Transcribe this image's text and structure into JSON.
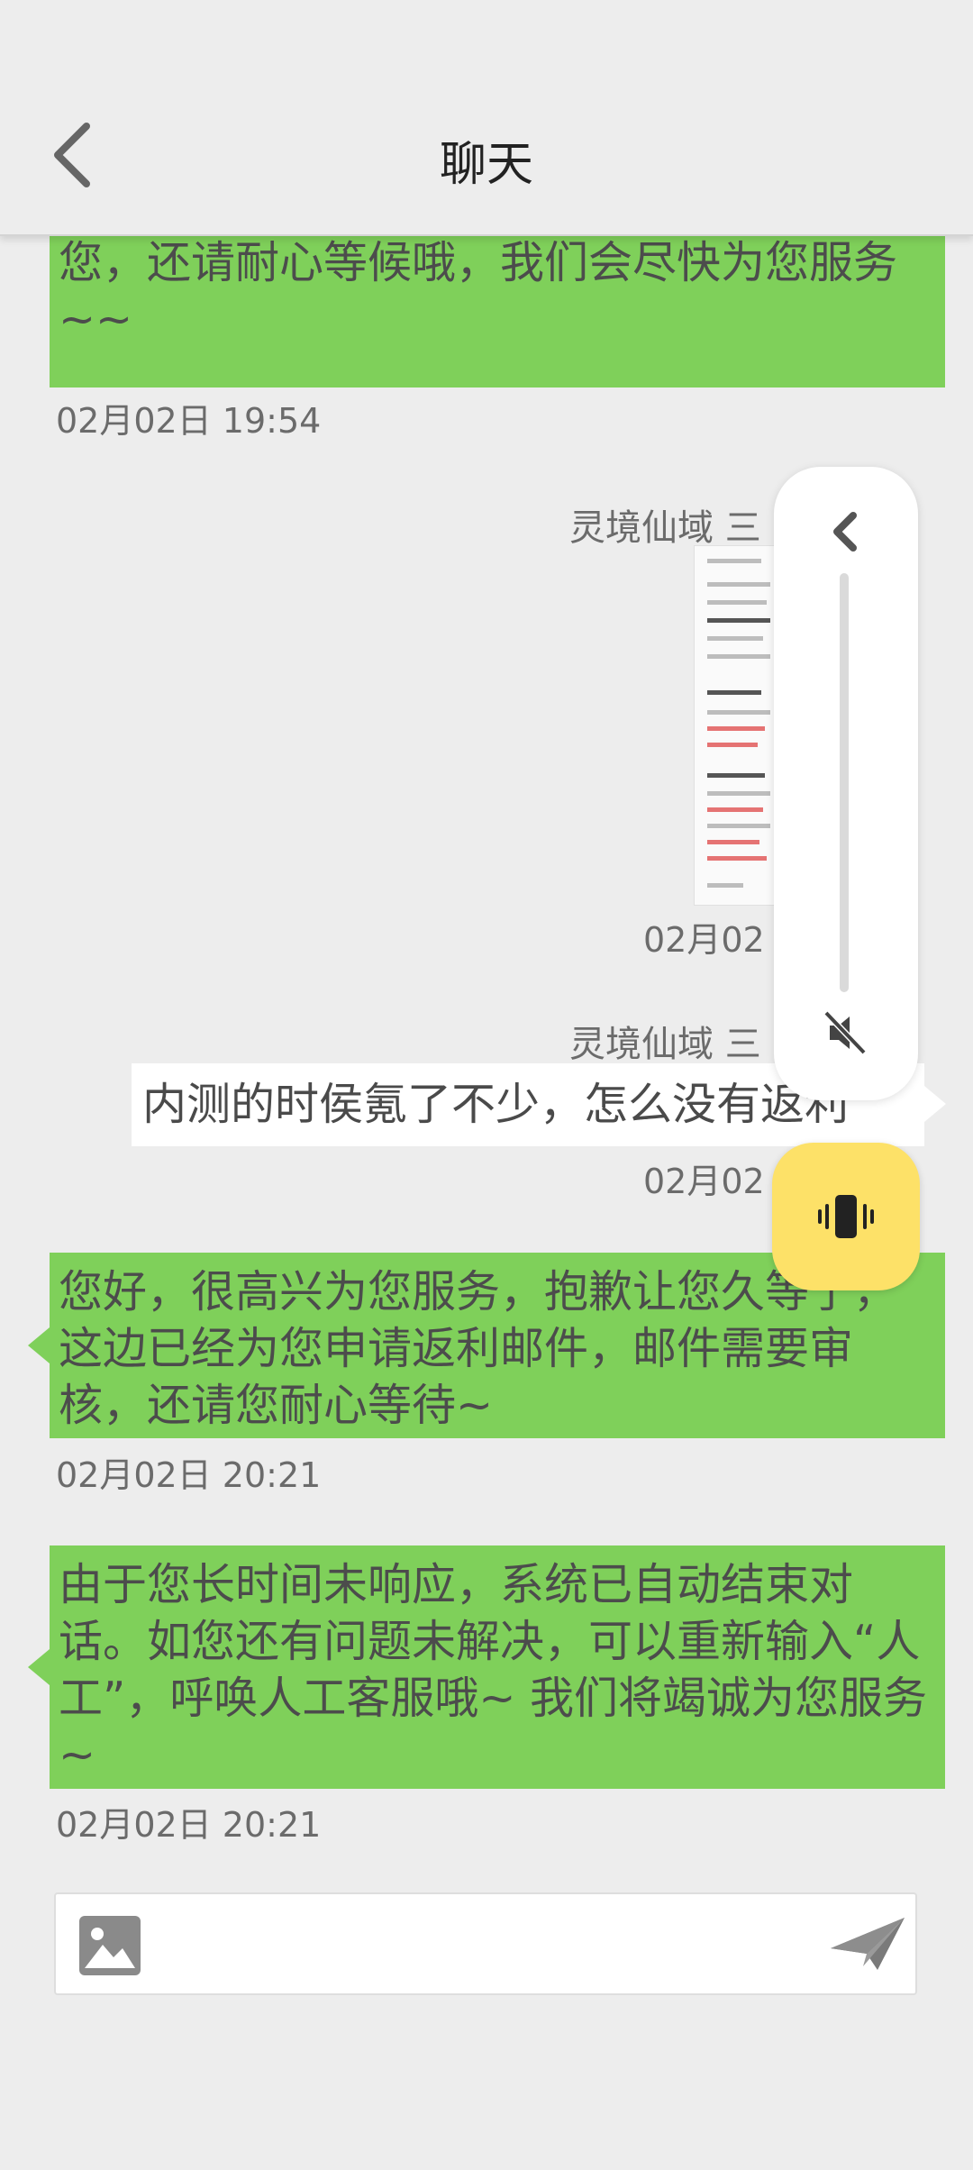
{
  "header": {
    "title": "聊天",
    "back_icon": "chevron-left-icon"
  },
  "messages": [
    {
      "type": "received",
      "text": "问量较大，客服小姐姐们没有办法马上回复您，还请耐心等候哦，我们会尽快为您服务~~",
      "time": "02月02日 19:54"
    },
    {
      "type": "sent-image",
      "sender": "灵境仙域 三",
      "time": "02月02"
    },
    {
      "type": "sent-text",
      "sender": "灵境仙域 三",
      "text": "内测的时侯氪了不少，怎么没有返利",
      "time": "02月02"
    },
    {
      "type": "received",
      "text": "您好，很高兴为您服务，抱歉让您久等了，这边已经为您申请返利邮件，邮件需要审核，还请您耐心等待~",
      "time": "02月02日 20:21"
    },
    {
      "type": "received",
      "text": "由于您长时间未响应，系统已自动结束对话。如您还有问题未解决，可以重新输入“人工”，呼唤人工客服哦~ 我们将竭诚为您服务~",
      "time": "02月02日 20:21"
    }
  ],
  "floating_panel": {
    "collapse_icon": "chevron-left-icon",
    "mute_icon": "volume-mute-icon",
    "vibrate_icon": "vibrate-icon"
  },
  "input_bar": {
    "value": "",
    "placeholder": "",
    "image_icon": "image-icon",
    "send_icon": "send-icon"
  },
  "colors": {
    "received_bubble": "#7fd05a",
    "sent_bubble": "#ffffff",
    "vibrate_button": "#fde168",
    "background": "#ededed"
  }
}
